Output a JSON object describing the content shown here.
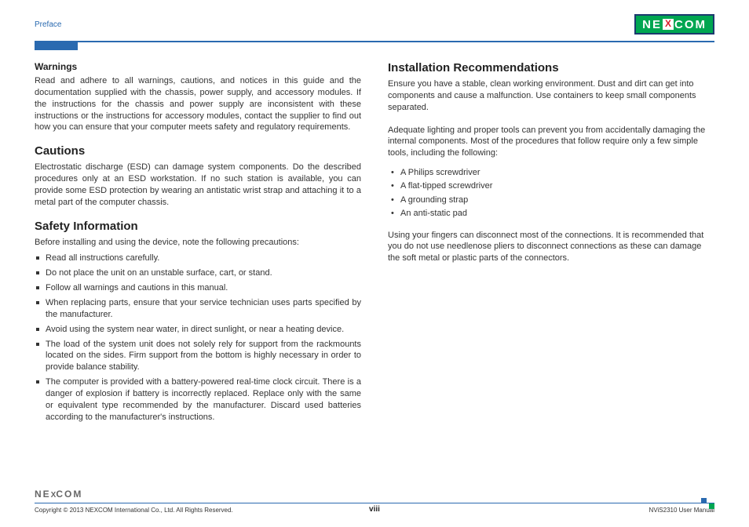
{
  "header": {
    "section_label": "Preface",
    "logo_left": "NE",
    "logo_x": "X",
    "logo_right": "COM"
  },
  "left": {
    "warnings_head": "Warnings",
    "warnings_body": "Read and adhere to all warnings, cautions, and notices in this guide and the documentation supplied with the chassis, power supply, and accessory modules. If the instructions for the chassis and power supply are inconsistent with these instructions or the instructions for accessory modules, contact the supplier to find out how you can ensure that your computer meets safety and regulatory requirements.",
    "cautions_head": "Cautions",
    "cautions_body": "Electrostatic discharge (ESD) can damage system components. Do the described procedures only at an ESD workstation. If no such station is available, you can provide some ESD protection by wearing an antistatic wrist strap and attaching it to a metal part of the computer chassis.",
    "safety_head": "Safety Information",
    "safety_lead": "Before installing and using the device, note the following precautions:",
    "safety_items": [
      "Read all instructions carefully.",
      "Do not place the unit on an unstable surface, cart, or stand.",
      "Follow all warnings and cautions in this manual.",
      "When replacing parts, ensure that your service technician uses parts specified by the manufacturer.",
      "Avoid using the system near water, in direct sunlight, or near a heating device.",
      "The load of the system unit does not solely rely for support from the rackmounts located on the sides. Firm support from the bottom is highly necessary in order to provide balance stability.",
      "The computer is provided with a battery-powered real-time clock circuit. There is a danger of explosion if battery is incorrectly replaced. Replace only with the same or equivalent type recommended by the manufacturer. Discard used batteries according to the manufacturer's instructions."
    ]
  },
  "right": {
    "install_head": "Installation Recommendations",
    "install_p1": "Ensure you have a stable, clean working environment. Dust and dirt can get into components and cause a malfunction. Use containers to keep small components separated.",
    "install_p2": "Adequate lighting and proper tools can prevent you from accidentally damaging the internal components. Most of the procedures that follow require only a few simple tools, including the following:",
    "tools": [
      "A Philips screwdriver",
      "A flat-tipped screwdriver",
      "A grounding strap",
      "An anti-static pad"
    ],
    "install_p3": "Using your fingers can disconnect most of the connections. It is recommended that you do not use needlenose pliers to disconnect connections as these can damage the soft metal or plastic parts of the connectors."
  },
  "footer": {
    "logo_left": "NE",
    "logo_x": "X",
    "logo_right": "COM",
    "copyright": "Copyright © 2013 NEXCOM International Co., Ltd. All Rights Reserved.",
    "page": "viii",
    "doc": "NViS2310 User Manual"
  }
}
